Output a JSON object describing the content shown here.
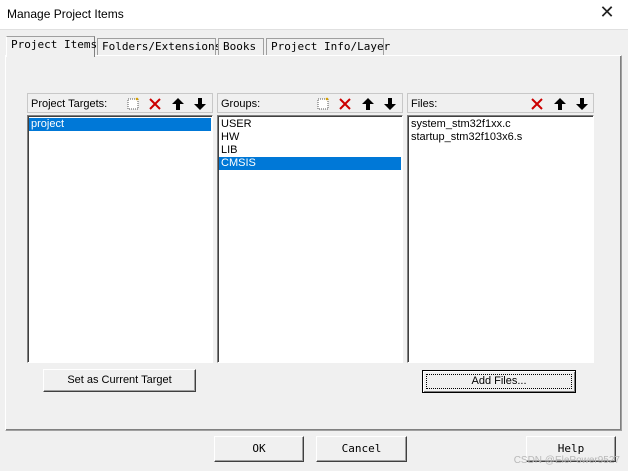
{
  "window": {
    "title": "Manage Project Items"
  },
  "tabs": [
    {
      "label": "Project Items",
      "active": true
    },
    {
      "label": "Folders/Extensions",
      "active": false
    },
    {
      "label": "Books",
      "active": false
    },
    {
      "label": "Project Info/Layer",
      "active": false
    }
  ],
  "targets": {
    "label": "Project Targets:",
    "items": [
      {
        "label": "project",
        "selected": true
      }
    ]
  },
  "groups": {
    "label": "Groups:",
    "items": [
      {
        "label": "USER",
        "selected": false
      },
      {
        "label": "HW",
        "selected": false
      },
      {
        "label": "LIB",
        "selected": false
      },
      {
        "label": "CMSIS",
        "selected": true
      }
    ]
  },
  "files": {
    "label": "Files:",
    "items": [
      {
        "label": "system_stm32f1xx.c",
        "selected": false
      },
      {
        "label": "startup_stm32f103x6.s",
        "selected": false
      }
    ]
  },
  "buttons": {
    "set_current_target": "Set as Current Target",
    "add_files": "Add Files...",
    "ok": "OK",
    "cancel": "Cancel",
    "help": "Help"
  },
  "watermark": "CSDN @ElePower9527",
  "colors": {
    "selection": "#0078d7",
    "delete_red": "#cc0000"
  }
}
